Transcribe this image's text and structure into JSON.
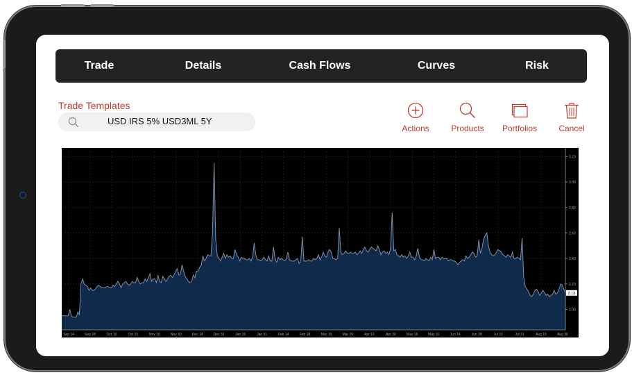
{
  "nav": {
    "items": [
      {
        "label": "Trade"
      },
      {
        "label": "Details"
      },
      {
        "label": "Cash Flows"
      },
      {
        "label": "Curves"
      },
      {
        "label": "Risk"
      }
    ]
  },
  "trade_templates": {
    "label": "Trade Templates",
    "search_icon": "search-icon",
    "value": "USD IRS 5% USD3ML 5Y"
  },
  "actions": [
    {
      "label": "Actions",
      "icon": "plus-circle-icon"
    },
    {
      "label": "Products",
      "icon": "magnifier-icon"
    },
    {
      "label": "Portfolios",
      "icon": "folders-icon"
    },
    {
      "label": "Cancel",
      "icon": "trash-icon"
    }
  ],
  "colors": {
    "accent": "#c0392b",
    "nav_bg": "#232323",
    "chart_bg": "#000000",
    "chart_fill": "#0f2a4a",
    "chart_line": "#7f8ea3"
  },
  "chart_data": {
    "type": "area",
    "x_ticks": [
      "Sep 14",
      "Sep 28",
      "Oct 15",
      "Oct 31",
      "Nov 15",
      "Nov 30",
      "Dec 14",
      "Dec 31",
      "Jan 15",
      "Jan 31",
      "Feb 14",
      "Feb 28",
      "Mar 15",
      "Mar 29",
      "Apr 15",
      "Apr 30",
      "May 15",
      "May 31",
      "Jun 14",
      "Jun 28",
      "Jul 15",
      "Jul 31",
      "Aug 15",
      "Aug 30"
    ],
    "y_ticks": [
      "3.20",
      "3.00",
      "2.80",
      "2.60",
      "2.40",
      "2.20",
      "2.00"
    ],
    "ylim": [
      1.84,
      3.24
    ],
    "last_value_label": "2.13",
    "values": [
      1.95,
      1.95,
      1.95,
      1.95,
      1.95,
      2.0,
      1.95,
      1.94,
      1.94,
      1.94,
      1.98,
      1.96,
      2.2,
      2.24,
      2.2,
      2.19,
      2.18,
      2.15,
      2.17,
      2.15,
      2.15,
      2.16,
      2.18,
      2.19,
      2.18,
      2.17,
      2.17,
      2.17,
      2.18,
      2.18,
      2.17,
      2.17,
      2.19,
      2.18,
      2.2,
      2.22,
      2.2,
      2.17,
      2.2,
      2.21,
      2.22,
      2.2,
      2.19,
      2.2,
      2.22,
      2.21,
      2.21,
      2.25,
      2.22,
      2.2,
      2.21,
      2.21,
      2.24,
      2.22,
      2.25,
      2.28,
      2.22,
      2.24,
      2.24,
      2.21,
      2.27,
      2.22,
      2.21,
      2.26,
      2.24,
      2.22,
      2.24,
      2.26,
      2.27,
      2.25,
      2.27,
      2.3,
      2.32,
      2.27,
      2.28,
      2.35,
      2.3,
      2.26,
      2.24,
      2.22,
      2.21,
      2.22,
      2.27,
      2.25,
      2.3,
      2.3,
      2.33,
      2.35,
      2.42,
      2.38,
      2.4,
      2.43,
      2.42,
      2.42,
      2.6,
      3.15,
      2.55,
      2.42,
      2.4,
      2.38,
      2.41,
      2.44,
      2.4,
      2.43,
      2.41,
      2.42,
      2.4,
      2.4,
      2.47,
      2.43,
      2.41,
      2.38,
      2.41,
      2.4,
      2.4,
      2.39,
      2.39,
      2.4,
      2.38,
      2.41,
      2.52,
      2.43,
      2.39,
      2.39,
      2.38,
      2.39,
      2.41,
      2.39,
      2.38,
      2.42,
      2.38,
      2.38,
      2.49,
      2.4,
      2.37,
      2.41,
      2.39,
      2.4,
      2.39,
      2.38,
      2.4,
      2.45,
      2.39,
      2.38,
      2.38,
      2.38,
      2.39,
      2.4,
      2.36,
      2.38,
      2.57,
      2.38,
      2.38,
      2.38,
      2.39,
      2.38,
      2.38,
      2.4,
      2.39,
      2.4,
      2.43,
      2.39,
      2.41,
      2.45,
      2.42,
      2.41,
      2.45,
      2.47,
      2.45,
      2.4,
      2.4,
      2.39,
      2.4,
      2.64,
      2.45,
      2.43,
      2.44,
      2.46,
      2.44,
      2.44,
      2.45,
      2.44,
      2.44,
      2.45,
      2.43,
      2.44,
      2.46,
      2.44,
      2.47,
      2.49,
      2.46,
      2.45,
      2.47,
      2.49,
      2.48,
      2.47,
      2.46,
      2.5,
      2.47,
      2.43,
      2.45,
      2.46,
      2.44,
      2.45,
      2.43,
      2.48,
      2.76,
      2.46,
      2.47,
      2.43,
      2.42,
      2.41,
      2.43,
      2.41,
      2.42,
      2.4,
      2.42,
      2.45,
      2.41,
      2.41,
      2.39,
      2.42,
      2.48,
      2.41,
      2.39,
      2.39,
      2.38,
      2.4,
      2.39,
      2.38,
      2.41,
      2.39,
      2.47,
      2.4,
      2.41,
      2.41,
      2.39,
      2.41,
      2.4,
      2.4,
      2.4,
      2.38,
      2.39,
      2.39,
      2.38,
      2.38,
      2.37,
      2.35,
      2.37,
      2.38,
      2.39,
      2.38,
      2.42,
      2.4,
      2.41,
      2.43,
      2.45,
      2.44,
      2.41,
      2.42,
      2.55,
      2.44,
      2.48,
      2.55,
      2.58,
      2.6,
      2.5,
      2.45,
      2.43,
      2.42,
      2.43,
      2.45,
      2.47,
      2.46,
      2.45,
      2.43,
      2.42,
      2.41,
      2.43,
      2.42,
      2.41,
      2.45,
      2.4,
      2.4,
      2.41,
      2.4,
      2.39,
      2.56,
      2.25,
      2.18,
      2.16,
      2.14,
      2.11,
      2.1,
      2.12,
      2.15,
      2.16,
      2.14,
      2.11,
      2.13,
      2.15,
      2.13,
      2.11,
      2.12,
      2.1,
      2.11,
      2.12,
      2.15,
      2.12,
      2.13,
      2.16,
      2.2,
      2.19,
      2.16,
      2.13
    ]
  }
}
